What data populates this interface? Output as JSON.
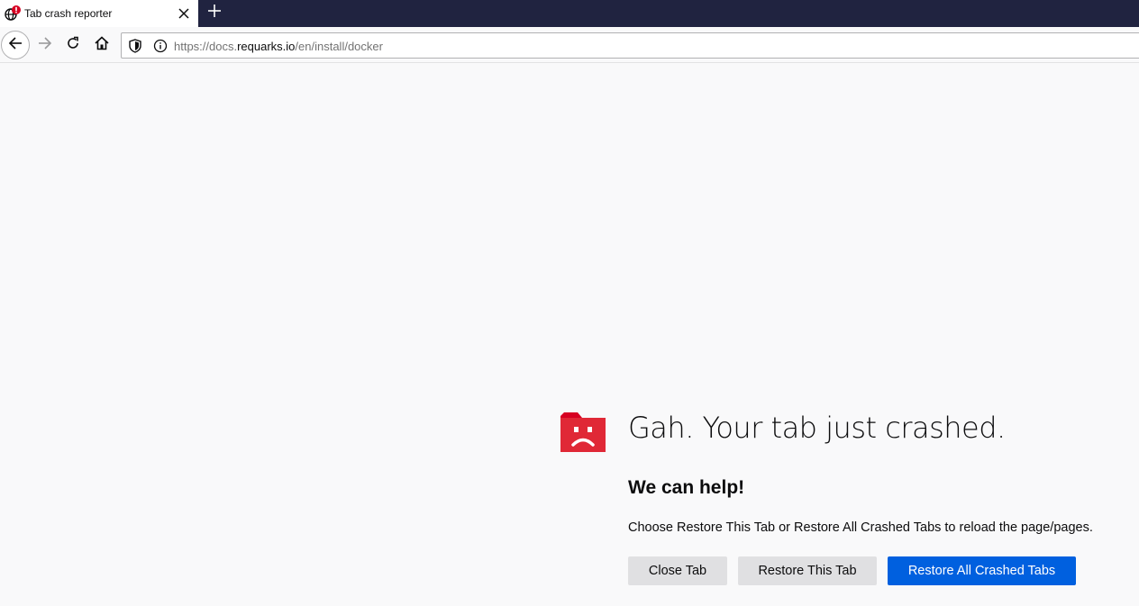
{
  "tab": {
    "title": "Tab crash reporter",
    "icon": "crashed-globe-icon"
  },
  "toolbar": {
    "back_icon": "back-arrow-icon",
    "forward_icon": "forward-arrow-icon",
    "reload_icon": "reload-icon",
    "home_icon": "home-icon",
    "new_tab_icon": "plus-icon"
  },
  "urlbar": {
    "prefix": "https://docs.",
    "host": "requarks.io",
    "path": "/en/install/docker"
  },
  "crash": {
    "title": "Gah. Your tab just crashed.",
    "subtitle": "We can help!",
    "description": "Choose Restore This Tab or Restore All Crashed Tabs to reload the page/pages.",
    "close_label": "Close Tab",
    "restore_label": "Restore This Tab",
    "restore_all_label": "Restore All Crashed Tabs"
  },
  "colors": {
    "tabstrip": "#202340",
    "primary_button": "#0060df",
    "crash_icon": "#d70022"
  }
}
